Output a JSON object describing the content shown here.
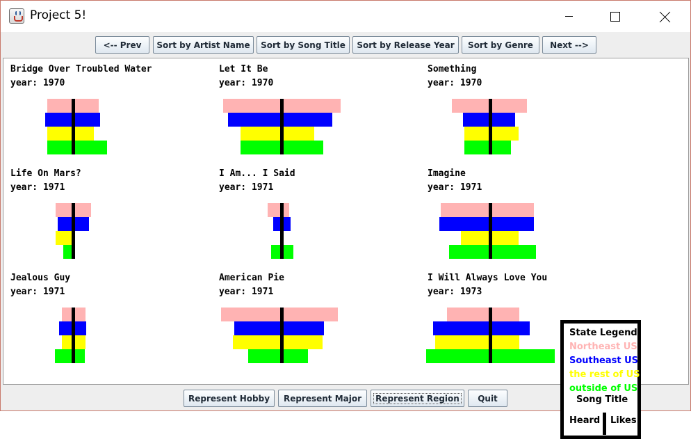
{
  "window": {
    "title": "Project 5!"
  },
  "top_buttons": [
    "<-- Prev",
    "Sort by Artist Name",
    "Sort by Song Title",
    "Sort by Release Year",
    "Sort by Genre",
    "Next -->"
  ],
  "bottom_buttons": [
    "Represent Hobby",
    "Represent Major",
    "Represent Region",
    "Quit"
  ],
  "focused_bottom_button": "Represent Region",
  "colors": {
    "northeast": "#ffb3b3",
    "southeast": "#0000ff",
    "rest": "#ffff00",
    "outside": "#00ff00",
    "axis": "#000000"
  },
  "songs": [
    {
      "title": "Bridge Over Troubled Water",
      "year": "year: 1970",
      "heard": [
        35,
        38,
        35,
        35
      ],
      "likes": [
        34,
        36,
        27,
        46
      ]
    },
    {
      "title": "Let It Be",
      "year": "year: 1970",
      "heard": [
        82,
        75,
        57,
        57
      ],
      "likes": [
        82,
        70,
        44,
        57
      ]
    },
    {
      "title": "Something",
      "year": "year: 1970",
      "heard": [
        53,
        37,
        35,
        35
      ],
      "likes": [
        50,
        33,
        38,
        27
      ]
    },
    {
      "title": "Life On Mars?",
      "year": "year: 1971",
      "heard": [
        23,
        20,
        23,
        12
      ],
      "likes": [
        23,
        20,
        0,
        0
      ]
    },
    {
      "title": "I Am... I Said",
      "year": "year: 1971",
      "heard": [
        18,
        10,
        0,
        13
      ],
      "likes": [
        8,
        10,
        0,
        14
      ]
    },
    {
      "title": "Imagine",
      "year": "year: 1971",
      "heard": [
        69,
        71,
        40,
        57
      ],
      "likes": [
        60,
        60,
        38,
        63
      ]
    },
    {
      "title": "Jealous Guy",
      "year": "year: 1971",
      "heard": [
        14,
        18,
        14,
        24
      ],
      "likes": [
        15,
        16,
        15,
        14
      ]
    },
    {
      "title": "American Pie",
      "year": "year: 1971",
      "heard": [
        85,
        66,
        68,
        46
      ],
      "likes": [
        78,
        58,
        56,
        35
      ]
    },
    {
      "title": "I Will Always Love You",
      "year": "year: 1973",
      "heard": [
        60,
        80,
        77,
        90
      ],
      "likes": [
        39,
        54,
        39,
        90
      ]
    }
  ],
  "legend": {
    "title": "State Legend",
    "northeast": "Northeast US",
    "southeast": "Southeast US",
    "rest": "the rest of US",
    "outside": "outside of US",
    "song_title": "Song Title",
    "heard": "Heard",
    "likes": "Likes"
  }
}
